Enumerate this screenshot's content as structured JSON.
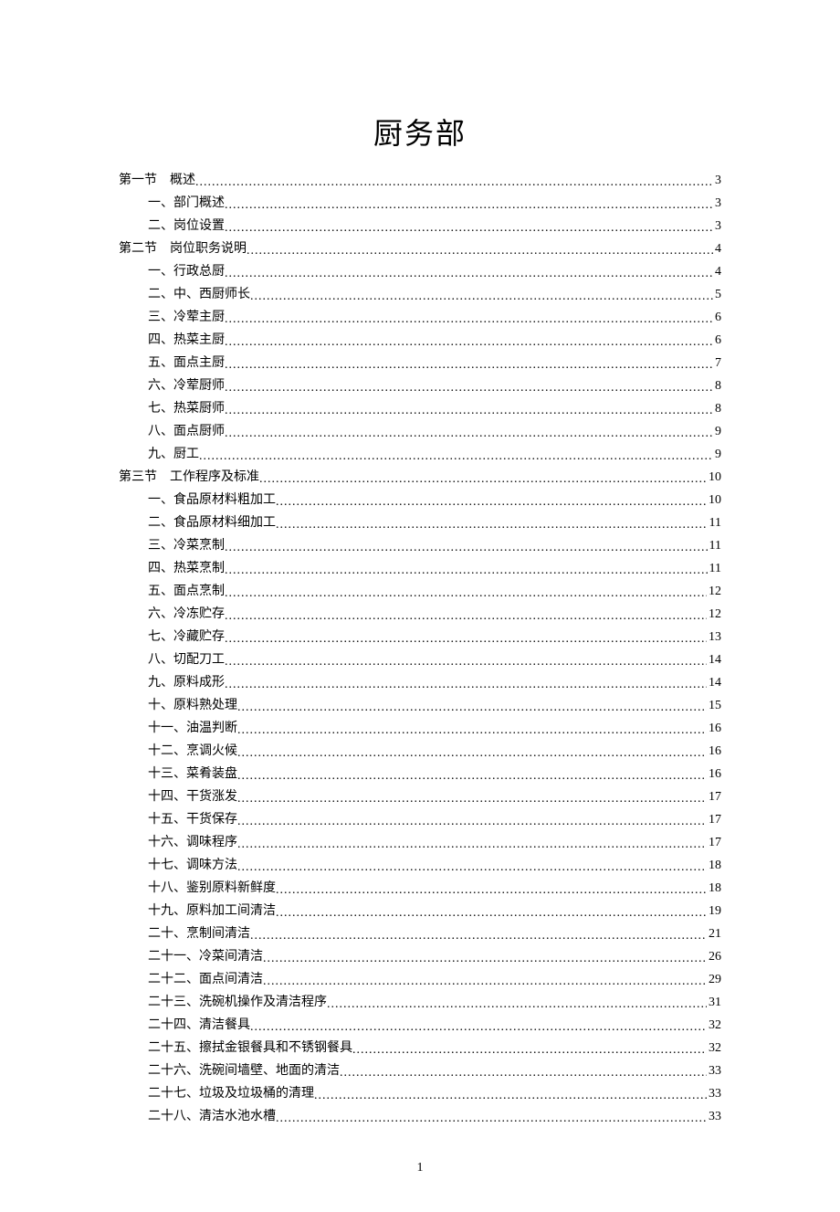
{
  "title": "厨务部",
  "page_number": "1",
  "toc": [
    {
      "level": 1,
      "label": "第一节　概述",
      "page": "3"
    },
    {
      "level": 2,
      "label": "一、部门概述",
      "page": "3"
    },
    {
      "level": 2,
      "label": "二、岗位设置",
      "page": "3"
    },
    {
      "level": 1,
      "label": "第二节　岗位职务说明",
      "page": "4"
    },
    {
      "level": 2,
      "label": "一、行政总厨",
      "page": "4"
    },
    {
      "level": 2,
      "label": "二、中、西厨师长",
      "page": "5"
    },
    {
      "level": 2,
      "label": "三、冷荤主厨",
      "page": "6"
    },
    {
      "level": 2,
      "label": "四、热菜主厨",
      "page": "6"
    },
    {
      "level": 2,
      "label": "五、面点主厨",
      "page": "7"
    },
    {
      "level": 2,
      "label": "六、冷荤厨师",
      "page": "8"
    },
    {
      "level": 2,
      "label": "七、热菜厨师",
      "page": "8"
    },
    {
      "level": 2,
      "label": "八、面点厨师",
      "page": "9"
    },
    {
      "level": 2,
      "label": "九、厨工",
      "page": "9"
    },
    {
      "level": 1,
      "label": "第三节　工作程序及标准",
      "page": "10"
    },
    {
      "level": 2,
      "label": "一、食品原材料粗加工",
      "page": "10"
    },
    {
      "level": 2,
      "label": "二、食品原材料细加工",
      "page": "11"
    },
    {
      "level": 2,
      "label": "三、冷菜烹制",
      "page": "11"
    },
    {
      "level": 2,
      "label": "四、热菜烹制",
      "page": "11"
    },
    {
      "level": 2,
      "label": "五、面点烹制",
      "page": "12"
    },
    {
      "level": 2,
      "label": "六、冷冻贮存",
      "page": "12"
    },
    {
      "level": 2,
      "label": "七、冷藏贮存",
      "page": "13"
    },
    {
      "level": 2,
      "label": "八、切配刀工",
      "page": "14"
    },
    {
      "level": 2,
      "label": "九、原料成形",
      "page": "14"
    },
    {
      "level": 2,
      "label": "十、原料熟处理",
      "page": "15"
    },
    {
      "level": 2,
      "label": "十一、油温判断",
      "page": "16"
    },
    {
      "level": 2,
      "label": "十二、烹调火候",
      "page": "16"
    },
    {
      "level": 2,
      "label": "十三、菜肴装盘",
      "page": "16"
    },
    {
      "level": 2,
      "label": "十四、干货涨发",
      "page": "17"
    },
    {
      "level": 2,
      "label": "十五、干货保存",
      "page": "17"
    },
    {
      "level": 2,
      "label": "十六、调味程序",
      "page": "17"
    },
    {
      "level": 2,
      "label": "十七、调味方法",
      "page": "18"
    },
    {
      "level": 2,
      "label": "十八、鉴别原料新鲜度",
      "page": "18"
    },
    {
      "level": 2,
      "label": "十九、原料加工间清洁",
      "page": "19"
    },
    {
      "level": 2,
      "label": "二十、烹制间清洁",
      "page": "21"
    },
    {
      "level": 2,
      "label": "二十一、冷菜间清洁",
      "page": "26"
    },
    {
      "level": 2,
      "label": "二十二、面点间清洁",
      "page": "29"
    },
    {
      "level": 2,
      "label": "二十三、洗碗机操作及清洁程序",
      "page": "31"
    },
    {
      "level": 2,
      "label": "二十四、清洁餐具",
      "page": "32"
    },
    {
      "level": 2,
      "label": "二十五、擦拭金银餐具和不锈钢餐具",
      "page": "32"
    },
    {
      "level": 2,
      "label": "二十六、洗碗间墙壁、地面的清洁",
      "page": "33"
    },
    {
      "level": 2,
      "label": "二十七、垃圾及垃圾桶的清理",
      "page": "33"
    },
    {
      "level": 2,
      "label": "二十八、清洁水池水槽",
      "page": "33"
    }
  ]
}
